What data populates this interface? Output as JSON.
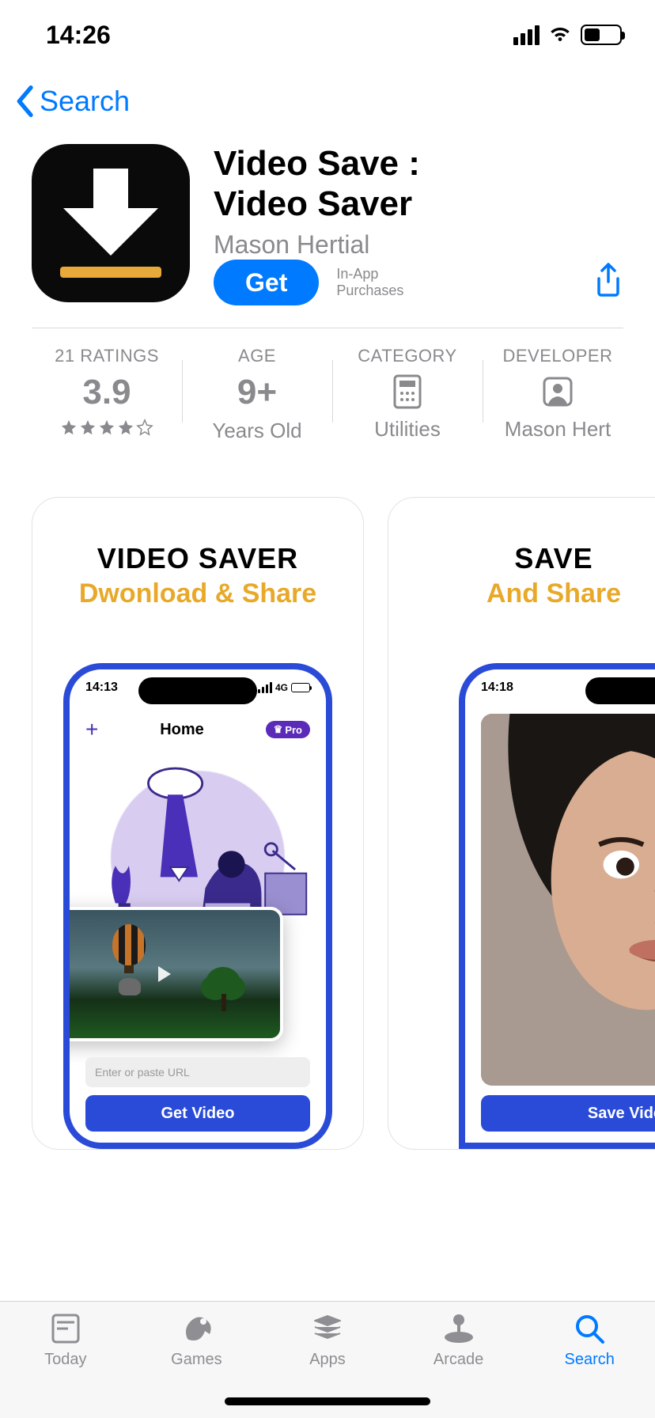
{
  "status": {
    "time": "14:26"
  },
  "nav": {
    "back_label": "Search"
  },
  "app": {
    "title_line1": "Video Save :",
    "title_line2": "Video Saver",
    "subtitle": "Mason Hertial",
    "get_label": "Get",
    "iap_line1": "In-App",
    "iap_line2": "Purchases"
  },
  "info": {
    "ratings": {
      "label": "21 RATINGS",
      "value": "3.9",
      "stars": 4
    },
    "age": {
      "label": "AGE",
      "value": "9+",
      "sub": "Years Old"
    },
    "category": {
      "label": "CATEGORY",
      "sub": "Utilities"
    },
    "developer": {
      "label": "DEVELOPER",
      "sub": "Mason Hert"
    }
  },
  "shots": {
    "s1": {
      "h1": "VIDEO SAVER",
      "h2": "Dwonload & Share",
      "phone": {
        "time": "14:13",
        "net": "4G",
        "home": "Home",
        "pro": "Pro",
        "placeholder": "Enter or paste URL",
        "cta": "Get Video"
      }
    },
    "s2": {
      "h1": "SAVE",
      "h2": "And Share",
      "phone": {
        "time": "14:18",
        "cta": "Save Vide"
      }
    }
  },
  "tabs": {
    "today": "Today",
    "games": "Games",
    "apps": "Apps",
    "arcade": "Arcade",
    "search": "Search"
  }
}
